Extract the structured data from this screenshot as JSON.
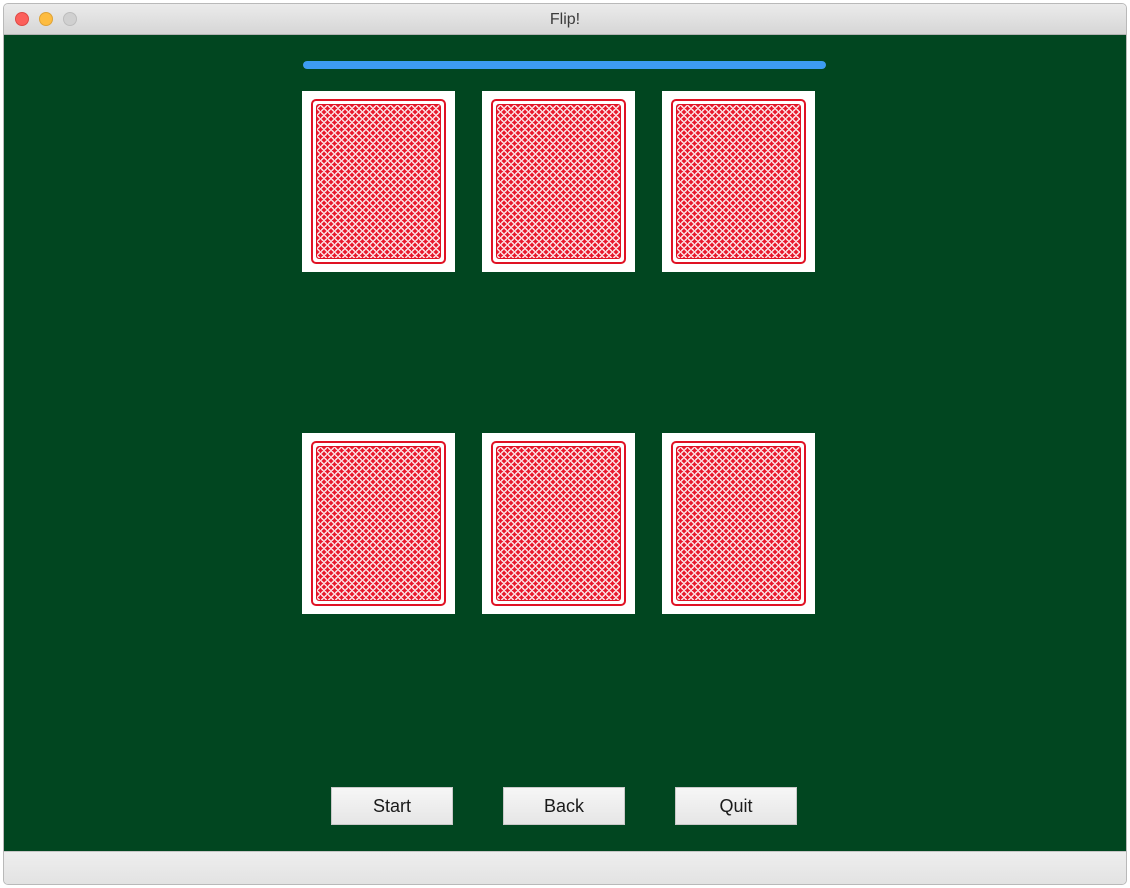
{
  "window": {
    "title": "Flip!"
  },
  "progress": {
    "value": 1.0,
    "color": "#3c9cf2"
  },
  "colors": {
    "felt": "#014620",
    "card_back_red": "#e8182c"
  },
  "cards": [
    {
      "state": "face-down"
    },
    {
      "state": "face-down"
    },
    {
      "state": "face-down"
    },
    {
      "state": "face-down"
    },
    {
      "state": "face-down"
    },
    {
      "state": "face-down"
    }
  ],
  "buttons": {
    "start_label": "Start",
    "back_label": "Back",
    "quit_label": "Quit"
  }
}
